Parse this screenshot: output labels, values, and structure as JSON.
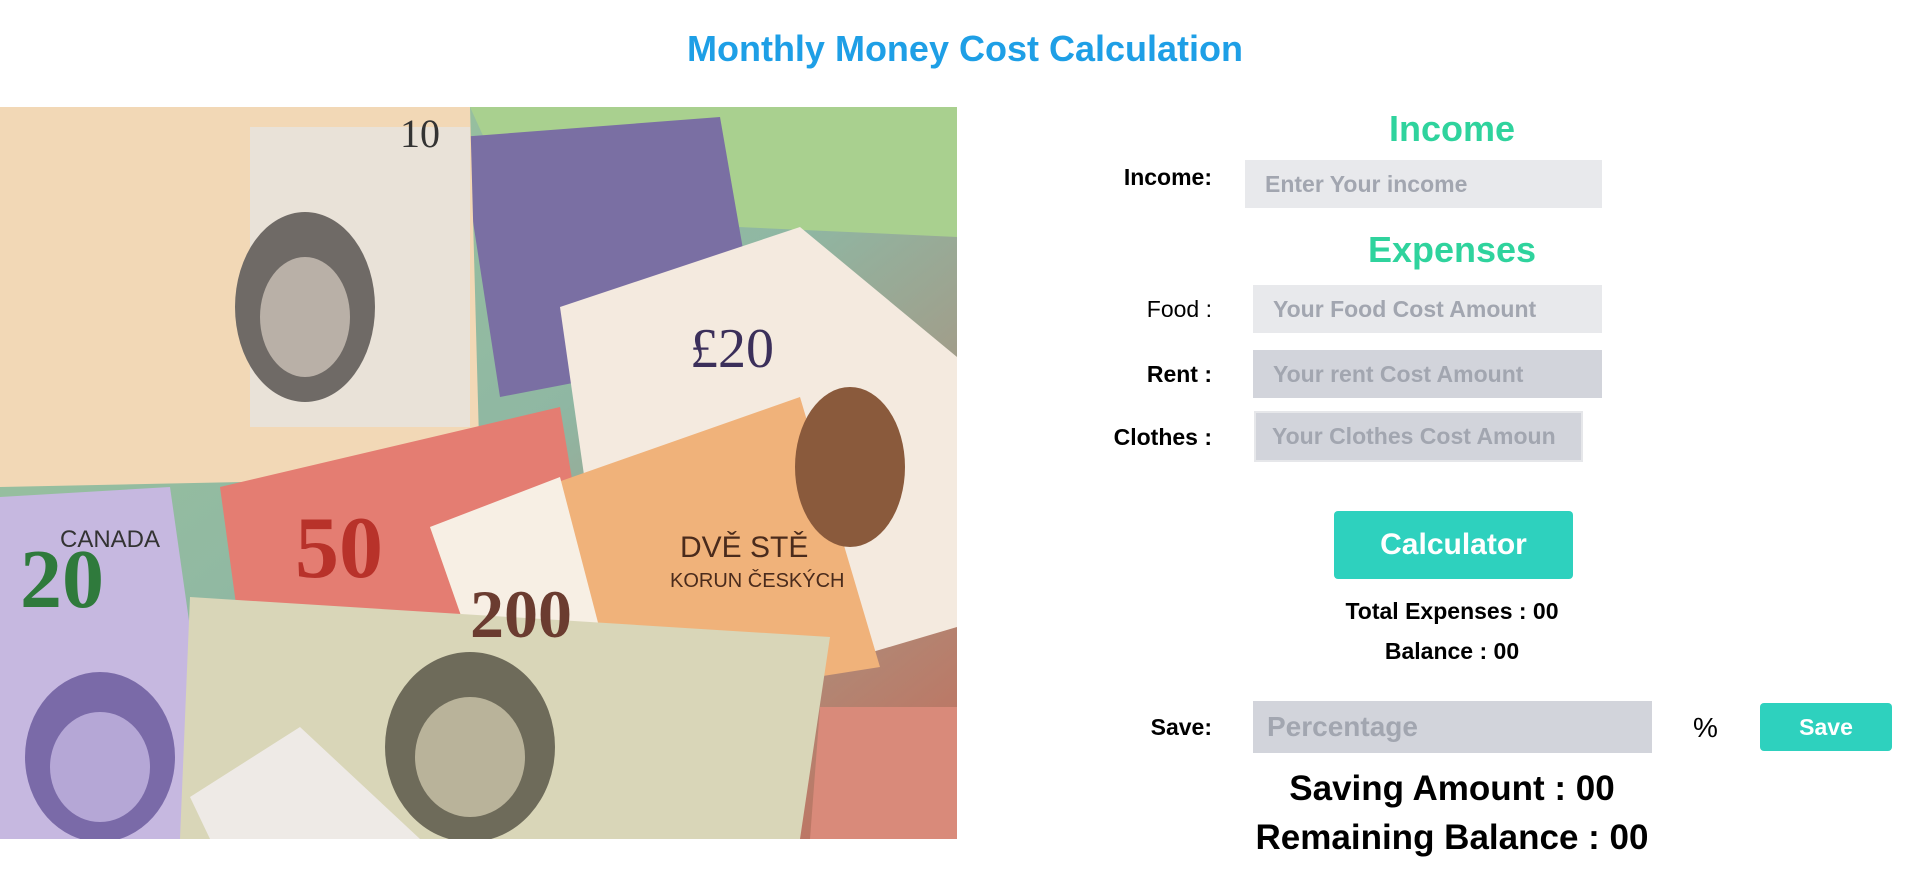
{
  "header": {
    "title": "Monthly Money Cost Calculation"
  },
  "image": {
    "name": "money-banknotes-photo",
    "banknote_texts": [
      "CANADA",
      "200",
      "50",
      "£20",
      "DVĚ STĚ",
      "KORUN ČESKÝCH",
      "10",
      "20"
    ]
  },
  "income": {
    "heading": "Income",
    "label": "Income:",
    "placeholder": "Enter Your income"
  },
  "expenses": {
    "heading": "Expenses",
    "food_label": "Food :",
    "food_placeholder": "Your Food Cost Amount",
    "rent_label": "Rent :",
    "rent_placeholder": "Your rent Cost Amount",
    "clothes_label": "Clothes :",
    "clothes_placeholder": "Your Clothes Cost Amoun"
  },
  "calculator": {
    "label": "Calculator"
  },
  "results": {
    "total_expenses": "Total Expenses : 00",
    "balance": "Balance : 00"
  },
  "save": {
    "label": "Save:",
    "placeholder": "Percentage",
    "percent_symbol": "%",
    "button_label": "Save"
  },
  "summary": {
    "saving_amount": "Saving Amount : 00",
    "remaining_balance": "Remaining Balance : 00"
  },
  "colors": {
    "title": "#1e9fe6",
    "section_heading": "#2fd39d",
    "button": "#2ed1be",
    "input_light": "#e8e9ec",
    "input_dark": "#d2d4db"
  }
}
